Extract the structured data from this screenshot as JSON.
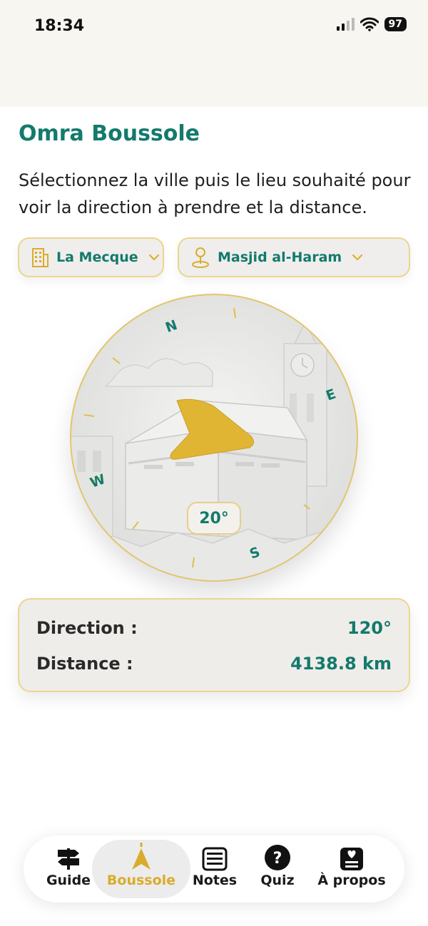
{
  "status": {
    "time": "18:34",
    "battery": "97"
  },
  "app": {
    "title": "Omra Boussole",
    "description": "Sélectionnez la ville puis le lieu souhaité pour voir la direction à prendre et la distance."
  },
  "selectors": {
    "city": "La Mecque",
    "place": "Masjid al-Haram"
  },
  "compass": {
    "heading_label": "20°",
    "cardinals": {
      "north": "N",
      "east": "E",
      "south": "S",
      "west": "W"
    }
  },
  "info": {
    "direction_label": "Direction :",
    "direction_value": "120°",
    "distance_label": "Distance :",
    "distance_value": "4138.8 km"
  },
  "tabs": [
    {
      "label": "Guide",
      "icon": "signpost-icon"
    },
    {
      "label": "Boussole",
      "icon": "compass-arrow-icon"
    },
    {
      "label": "Notes",
      "icon": "notes-icon"
    },
    {
      "label": "Quiz",
      "icon": "question-icon"
    },
    {
      "label": "À propos",
      "icon": "about-icon"
    }
  ],
  "colors": {
    "accent": "#137a6c",
    "gold": "#d9ac2c",
    "status_bg": "#f8f6f0"
  }
}
